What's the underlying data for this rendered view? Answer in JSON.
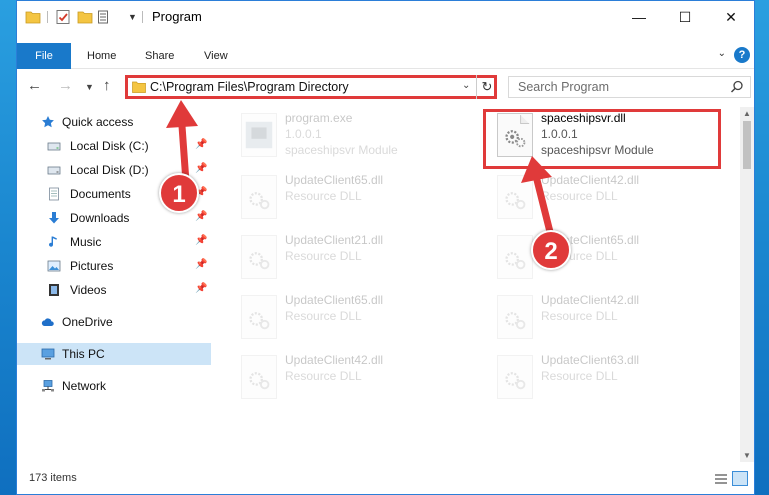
{
  "window": {
    "title": "Program",
    "controls": {
      "minimize": "—",
      "maximize": "☐",
      "close": "✕"
    }
  },
  "ribbon": {
    "tabs": [
      "File",
      "Home",
      "Share",
      "View"
    ]
  },
  "address": {
    "path": "C:\\Program Files\\Program Directory",
    "search_placeholder": "Search Program"
  },
  "sidebar": {
    "items": [
      {
        "label": "Quick access",
        "icon": "star-icon",
        "pinned": false
      },
      {
        "label": "Local Disk (C:)",
        "icon": "drive-icon",
        "pinned": true
      },
      {
        "label": "Local Disk (D:)",
        "icon": "drive-icon",
        "pinned": true
      },
      {
        "label": "Documents",
        "icon": "documents-icon",
        "pinned": true
      },
      {
        "label": "Downloads",
        "icon": "download-icon",
        "pinned": true
      },
      {
        "label": "Music",
        "icon": "music-icon",
        "pinned": true
      },
      {
        "label": "Pictures",
        "icon": "pictures-icon",
        "pinned": true
      },
      {
        "label": "Videos",
        "icon": "videos-icon",
        "pinned": true
      },
      {
        "label": "OneDrive",
        "icon": "cloud-icon",
        "pinned": false
      },
      {
        "label": "This PC",
        "icon": "computer-icon",
        "pinned": false
      },
      {
        "label": "Network",
        "icon": "network-icon",
        "pinned": false
      }
    ]
  },
  "files": [
    {
      "name": "program.exe",
      "line2": "1.0.0.1",
      "line3": "spaceshipsvr Module",
      "faded": true
    },
    {
      "name": "spaceshipsvr.dll",
      "line2": "1.0.0.1",
      "line3": "spaceshipsvr Module",
      "faded": false
    },
    {
      "name": "UpdateClient65.dll",
      "line2": "Resource DLL",
      "line3": "",
      "faded": true
    },
    {
      "name": "UpdateClient42.dll",
      "line2": "Resource DLL",
      "line3": "",
      "faded": true
    },
    {
      "name": "UpdateClient21.dll",
      "line2": "Resource DLL",
      "line3": "",
      "faded": true
    },
    {
      "name": "UpdateClient65.dll",
      "line2": "Resource DLL",
      "line3": "",
      "faded": true
    },
    {
      "name": "UpdateClient65.dll",
      "line2": "Resource DLL",
      "line3": "",
      "faded": true
    },
    {
      "name": "UpdateClient42.dll",
      "line2": "Resource DLL",
      "line3": "",
      "faded": true
    },
    {
      "name": "UpdateClient42.dll",
      "line2": "Resource DLL",
      "line3": "",
      "faded": true
    },
    {
      "name": "UpdateClient63.dll",
      "line2": "Resource DLL",
      "line3": "",
      "faded": true
    }
  ],
  "status": {
    "item_count": "173 items"
  },
  "annotations": {
    "step1": "1",
    "step2": "2",
    "color": "#e03a3a"
  }
}
